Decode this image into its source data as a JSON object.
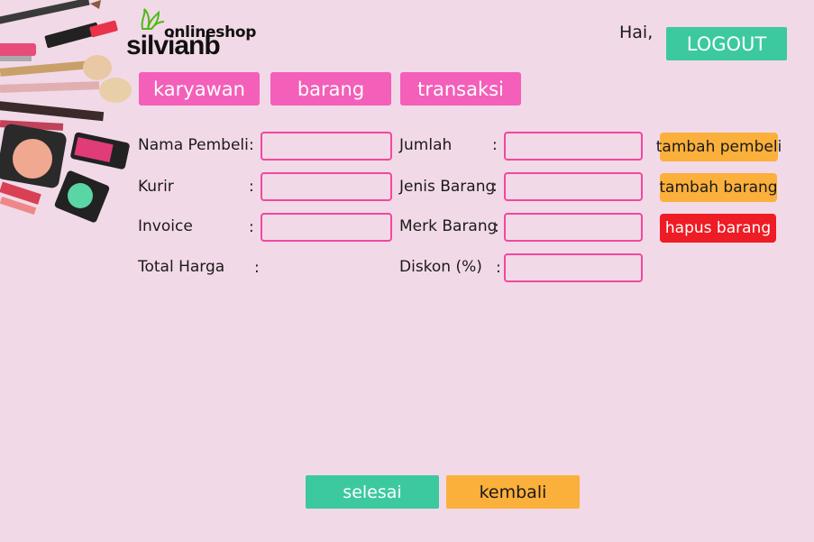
{
  "header": {
    "logo_top": "onlineshop",
    "logo_brand": "silvianb",
    "greeting": "Hai,",
    "logout_label": "LOGOUT"
  },
  "nav": [
    {
      "label": "karyawan"
    },
    {
      "label": "barang"
    },
    {
      "label": "transaksi"
    }
  ],
  "form": {
    "left": [
      {
        "label": "Nama Pembeli",
        "colon": ":",
        "value": ""
      },
      {
        "label": "Kurir",
        "colon": ":",
        "value": ""
      },
      {
        "label": "Invoice",
        "colon": ":",
        "value": ""
      },
      {
        "label": "Total Harga",
        "colon": ":"
      }
    ],
    "right": [
      {
        "label": "Jumlah",
        "colon": ":",
        "value": ""
      },
      {
        "label": "Jenis Barang",
        "colon": ":",
        "value": ""
      },
      {
        "label": "Merk Barang",
        "colon": ":",
        "value": ""
      },
      {
        "label": "Diskon (%)",
        "colon": ":",
        "value": ""
      }
    ]
  },
  "actions": {
    "tambah_pembeli": "tambah pembeli",
    "tambah_barang": "tambah barang",
    "hapus_barang": "hapus barang"
  },
  "footer": {
    "selesai": "selesai",
    "kembali": "kembali"
  },
  "colors": {
    "background": "#f2d9e7",
    "nav_pink": "#f45fb9",
    "teal": "#3cc9a0",
    "orange": "#fbb03b",
    "red": "#ee1c24",
    "input_border": "#f0489f"
  }
}
